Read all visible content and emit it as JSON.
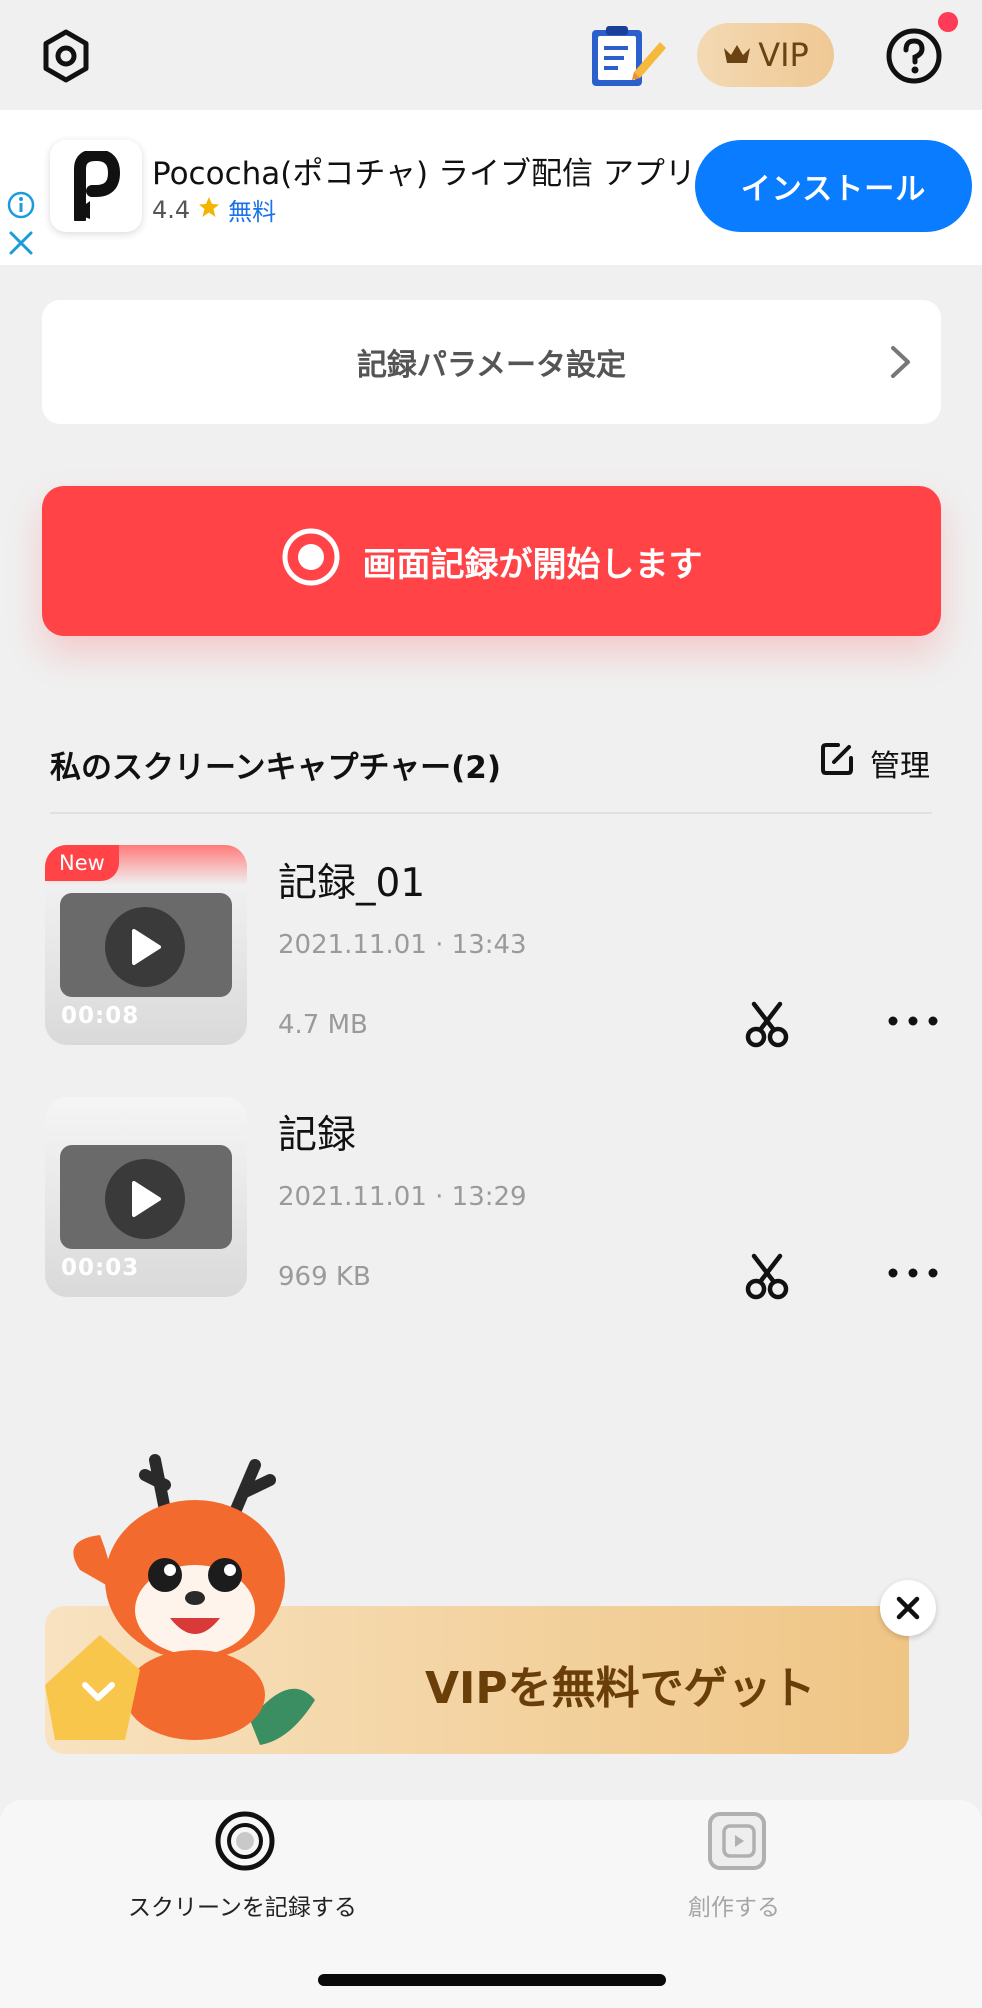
{
  "header": {
    "settings_icon": "gear-icon",
    "notes_icon": "notes-icon",
    "vip_label": "VIP",
    "help_icon": "question-icon"
  },
  "ad": {
    "app_name": "Pococha(ポコチャ) ライブ配信 アプリ",
    "rating": "4.4",
    "price": "無料",
    "install_label": "インストール",
    "colors": {
      "install": "#0a7cff"
    }
  },
  "params": {
    "label": "記録パラメータ設定"
  },
  "record": {
    "label": "画面記録が開始します",
    "color": "#ff4347"
  },
  "list": {
    "title": "私のスクリーンキャプチャー(2)",
    "manage_label": "管理",
    "items": [
      {
        "name": "記録_01",
        "date": "2021.11.01 · 13:43",
        "size": "4.7 MB",
        "duration": "00:08",
        "badge": "New"
      },
      {
        "name": "記録",
        "date": "2021.11.01 · 13:29",
        "size": "969 KB",
        "duration": "00:03",
        "badge": ""
      }
    ]
  },
  "promo": {
    "label": "VIPを無料でゲット"
  },
  "nav": {
    "items": [
      {
        "label": "スクリーンを記録する",
        "icon": "record-icon",
        "active": true
      },
      {
        "label": "創作する",
        "icon": "create-icon",
        "active": false
      }
    ]
  }
}
